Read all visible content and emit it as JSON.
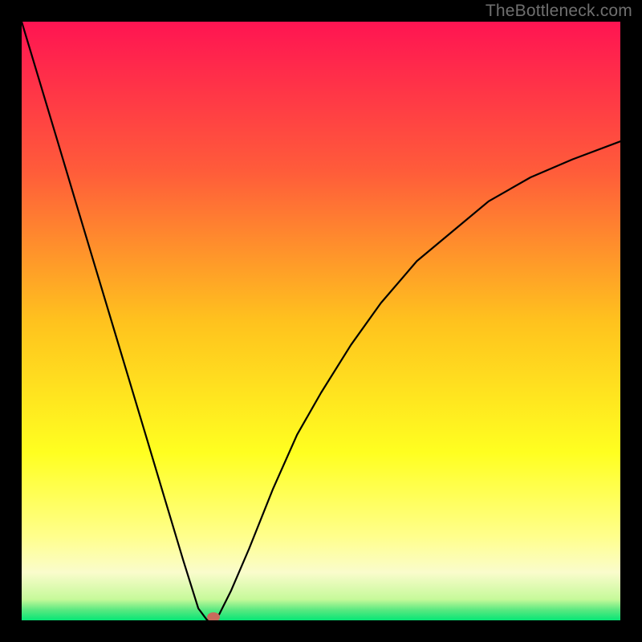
{
  "watermark": "TheBottleneck.com",
  "colors": {
    "black": "#000000",
    "curve": "#000000",
    "dot": "#c96a5c"
  },
  "chart_data": {
    "type": "line",
    "title": "",
    "xlabel": "",
    "ylabel": "",
    "xlim": [
      0,
      100
    ],
    "ylim": [
      0,
      100
    ],
    "notch_x": 31,
    "gradient_stops": [
      {
        "pos": 0,
        "color": "#ff1452"
      },
      {
        "pos": 25,
        "color": "#ff5c3a"
      },
      {
        "pos": 50,
        "color": "#ffc21e"
      },
      {
        "pos": 72,
        "color": "#ffff20"
      },
      {
        "pos": 86,
        "color": "#ffff8c"
      },
      {
        "pos": 92,
        "color": "#fafccc"
      },
      {
        "pos": 96.5,
        "color": "#c6f99a"
      },
      {
        "pos": 98.3,
        "color": "#58e880"
      },
      {
        "pos": 100,
        "color": "#06e676"
      }
    ],
    "series": [
      {
        "name": "bottleneck-curve",
        "x": [
          0,
          3,
          6,
          9,
          12,
          15,
          18,
          21,
          24,
          27,
          29.5,
          31,
          33,
          35,
          38,
          42,
          46,
          50,
          55,
          60,
          66,
          72,
          78,
          85,
          92,
          100
        ],
        "y": [
          100,
          90,
          80,
          70,
          60,
          50,
          40,
          30,
          20,
          10,
          2,
          0,
          1,
          5,
          12,
          22,
          31,
          38,
          46,
          53,
          60,
          65,
          70,
          74,
          77,
          80
        ]
      }
    ],
    "marker": {
      "x": 32,
      "y": 0.5
    }
  }
}
